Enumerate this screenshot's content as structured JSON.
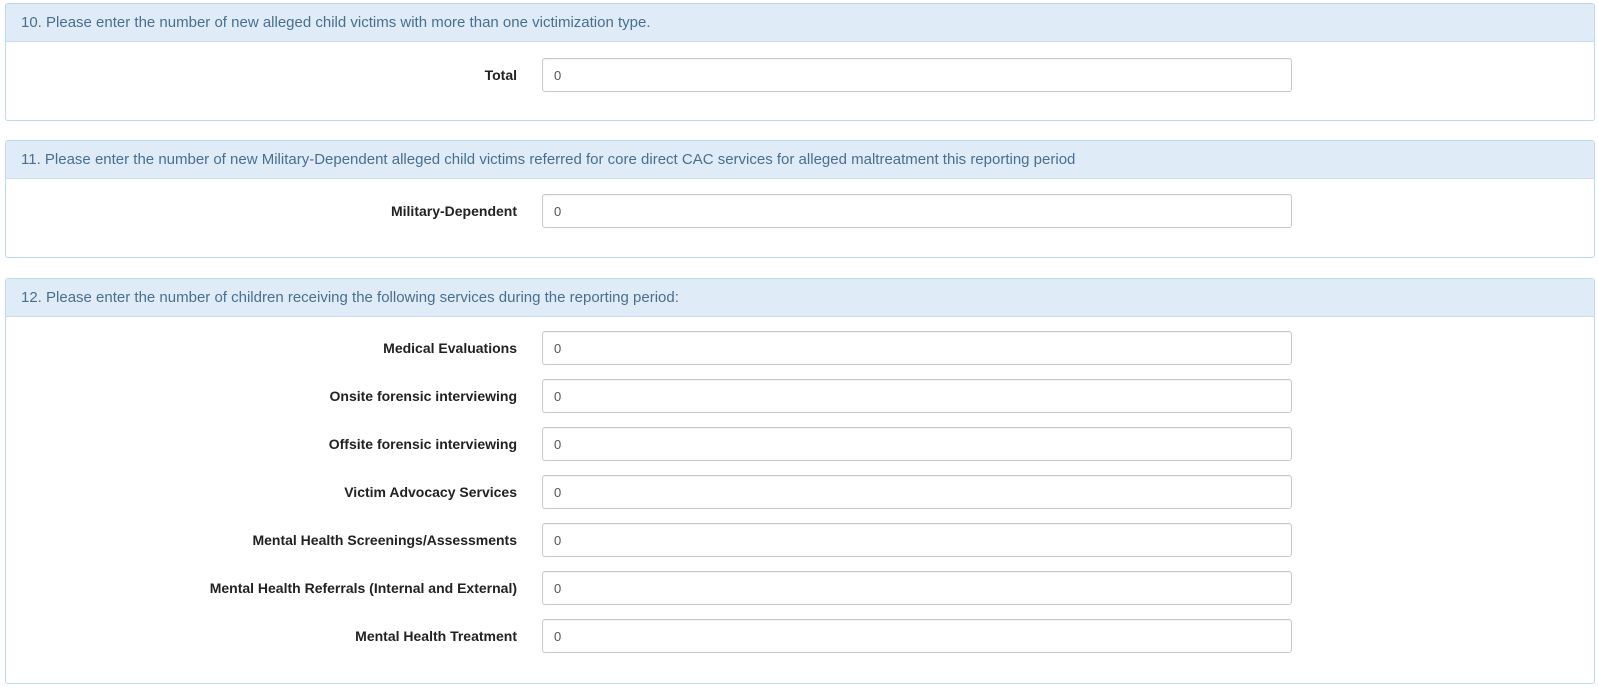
{
  "sections": [
    {
      "heading": "10. Please enter the number of new alleged child victims with more than one victimization type.",
      "fields": [
        {
          "label": "Total",
          "value": "0"
        }
      ]
    },
    {
      "heading": "11. Please enter the number of new Military-Dependent alleged child victims referred for core direct CAC services for alleged maltreatment this reporting period",
      "fields": [
        {
          "label": "Military-Dependent",
          "value": "0"
        }
      ]
    },
    {
      "heading": "12. Please enter the number of children receiving the following services during the reporting period:",
      "fields": [
        {
          "label": "Medical Evaluations",
          "value": "0"
        },
        {
          "label": "Onsite forensic interviewing",
          "value": "0"
        },
        {
          "label": "Offsite forensic interviewing",
          "value": "0"
        },
        {
          "label": "Victim Advocacy Services",
          "value": "0"
        },
        {
          "label": "Mental Health Screenings/Assessments",
          "value": "0"
        },
        {
          "label": "Mental Health Referrals (Internal and External)",
          "value": "0"
        },
        {
          "label": "Mental Health Treatment",
          "value": "0"
        }
      ]
    }
  ]
}
